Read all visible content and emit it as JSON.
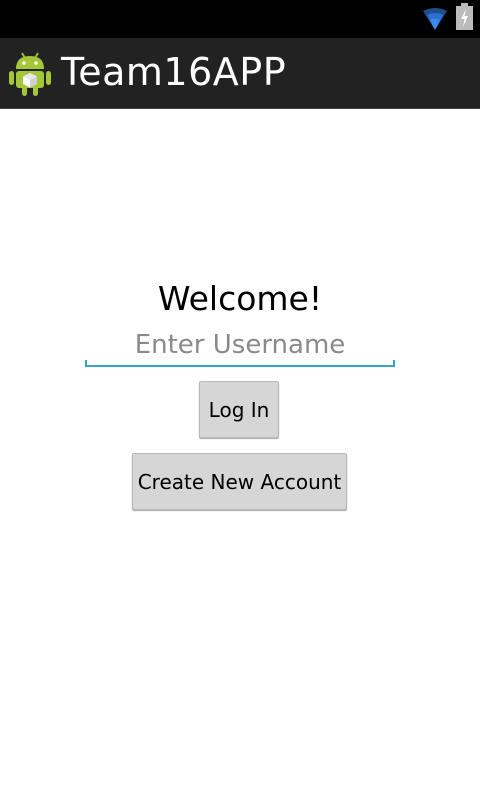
{
  "status_bar": {
    "wifi_icon": "wifi-icon",
    "battery_icon": "battery-charging-icon"
  },
  "action_bar": {
    "app_icon": "android-app-icon",
    "title": "Team16APP"
  },
  "main": {
    "welcome_text": "Welcome!",
    "username_placeholder": "Enter Username",
    "username_value": "",
    "login_label": "Log In",
    "create_account_label": "Create New Account"
  },
  "colors": {
    "status_bar_bg": "#000000",
    "action_bar_bg": "#222222",
    "input_accent": "#33a6c9",
    "button_bg": "#d6d6d6"
  }
}
